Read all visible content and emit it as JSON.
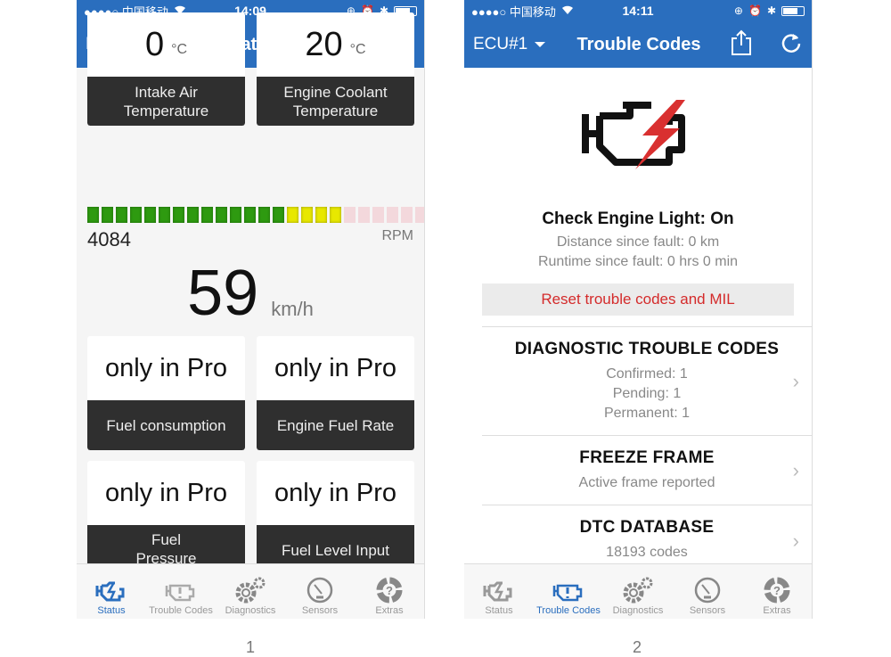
{
  "screens": [
    {
      "status_bar": {
        "carrier": "●●●●○ 中国移动",
        "time": "14:09"
      },
      "nav": {
        "ecu": "ECU#1",
        "title": "Status",
        "right_icon": "link-off-icon"
      },
      "tiles_top": [
        {
          "value": "0",
          "unit": "°C",
          "label": "Intake Air Temperature"
        },
        {
          "value": "20",
          "unit": "°C",
          "label": "Engine Coolant Temperature"
        }
      ],
      "rpm": {
        "value": "4084",
        "unit": "RPM",
        "segments_total": 25,
        "segments_lit": 18,
        "green_count": 14,
        "yellow_count": 4,
        "colors": {
          "green": "#2e9a10",
          "yellow": "#e8e800",
          "off": "#f3d8dc"
        }
      },
      "speed": {
        "value": "59",
        "unit": "km/h"
      },
      "tiles_bottom": [
        {
          "value": "only in Pro",
          "label": "Fuel consumption"
        },
        {
          "value": "only in Pro",
          "label": "Engine Fuel Rate"
        },
        {
          "value": "only in Pro",
          "label": "Fuel Pressure (gauge)"
        },
        {
          "value": "only in Pro",
          "label": "Fuel Level Input"
        }
      ],
      "caption": "1"
    },
    {
      "status_bar": {
        "carrier": "●●●●○ 中国移动",
        "time": "14:11"
      },
      "nav": {
        "ecu": "ECU#1",
        "title": "Trouble Codes"
      },
      "check_engine": "Check Engine Light: On",
      "distance": "Distance since fault: 0 km",
      "runtime": "Runtime since fault: 0 hrs 0 min",
      "reset_button": "Reset trouble codes and MIL",
      "rows": [
        {
          "title": "DIAGNOSTIC TROUBLE CODES",
          "lines": [
            "Confirmed: 1",
            "Pending: 1",
            "Permanent: 1"
          ]
        },
        {
          "title": "FREEZE FRAME",
          "lines": [
            "Active frame reported"
          ]
        },
        {
          "title": "DTC DATABASE",
          "lines": [
            "18193 codes"
          ]
        }
      ],
      "caption": "2"
    }
  ],
  "tabs": [
    "Status",
    "Trouble Codes",
    "Diagnostics",
    "Sensors",
    "Extras"
  ],
  "colors": {
    "accent": "#2a6ebe",
    "danger": "#d42b2b",
    "tile_label_bg": "#2f2f2f"
  }
}
